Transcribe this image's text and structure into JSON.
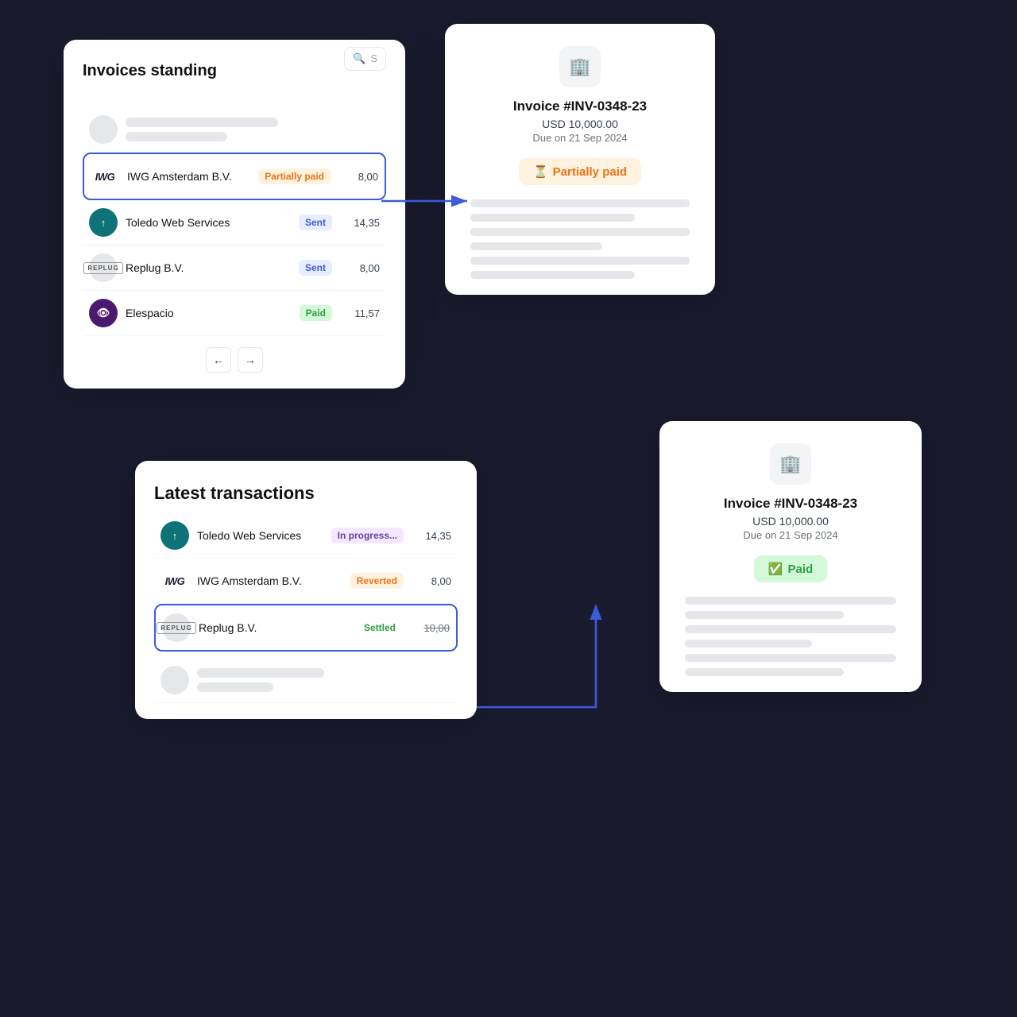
{
  "scene": {
    "background": "#111"
  },
  "invoices_panel": {
    "title": "Invoices standing",
    "search_placeholder": "S",
    "rows": [
      {
        "name": "IWG Amsterdam B.V.",
        "status": "Partially paid",
        "status_class": "badge-orange",
        "amount": "8,00",
        "highlighted": true,
        "logo_type": "iwg"
      },
      {
        "name": "Toledo Web Services",
        "status": "Sent",
        "status_class": "badge-blue",
        "amount": "14,35",
        "highlighted": false,
        "logo_type": "toledo"
      },
      {
        "name": "Replug B.V.",
        "status": "Sent",
        "status_class": "badge-blue",
        "amount": "8,00",
        "highlighted": false,
        "logo_type": "replug"
      },
      {
        "name": "Elespacio",
        "status": "Paid",
        "status_class": "badge-green",
        "amount": "11,57",
        "highlighted": false,
        "logo_type": "elespacio"
      }
    ],
    "prev_label": "←",
    "next_label": "→"
  },
  "invoice_detail_top": {
    "icon": "🏢",
    "number": "Invoice #INV-0348-23",
    "amount": "USD 10,000.00",
    "due": "Due on 21 Sep 2024",
    "status": "Partially paid",
    "status_class": "invoice-status-partial"
  },
  "transactions_panel": {
    "title": "Latest transactions",
    "rows": [
      {
        "name": "Toledo Web Services",
        "status": "In progress...",
        "status_class": "badge-inprogress",
        "amount": "14,35",
        "logo_type": "toledo"
      },
      {
        "name": "IWG Amsterdam B.V.",
        "status": "Reverted",
        "status_class": "badge-reverted",
        "amount": "8,00",
        "logo_type": "iwg"
      },
      {
        "name": "Replug B.V.",
        "status": "Settled",
        "status_class": "badge-settled",
        "amount": "10,00",
        "logo_type": "replug",
        "highlighted": true,
        "strikethrough": true
      }
    ]
  },
  "invoice_detail_bottom": {
    "icon": "🏢",
    "number": "Invoice #INV-0348-23",
    "amount": "USD 10,000.00",
    "due": "Due on 21 Sep 2024",
    "status": "Paid",
    "status_class": "invoice-status-paid"
  }
}
